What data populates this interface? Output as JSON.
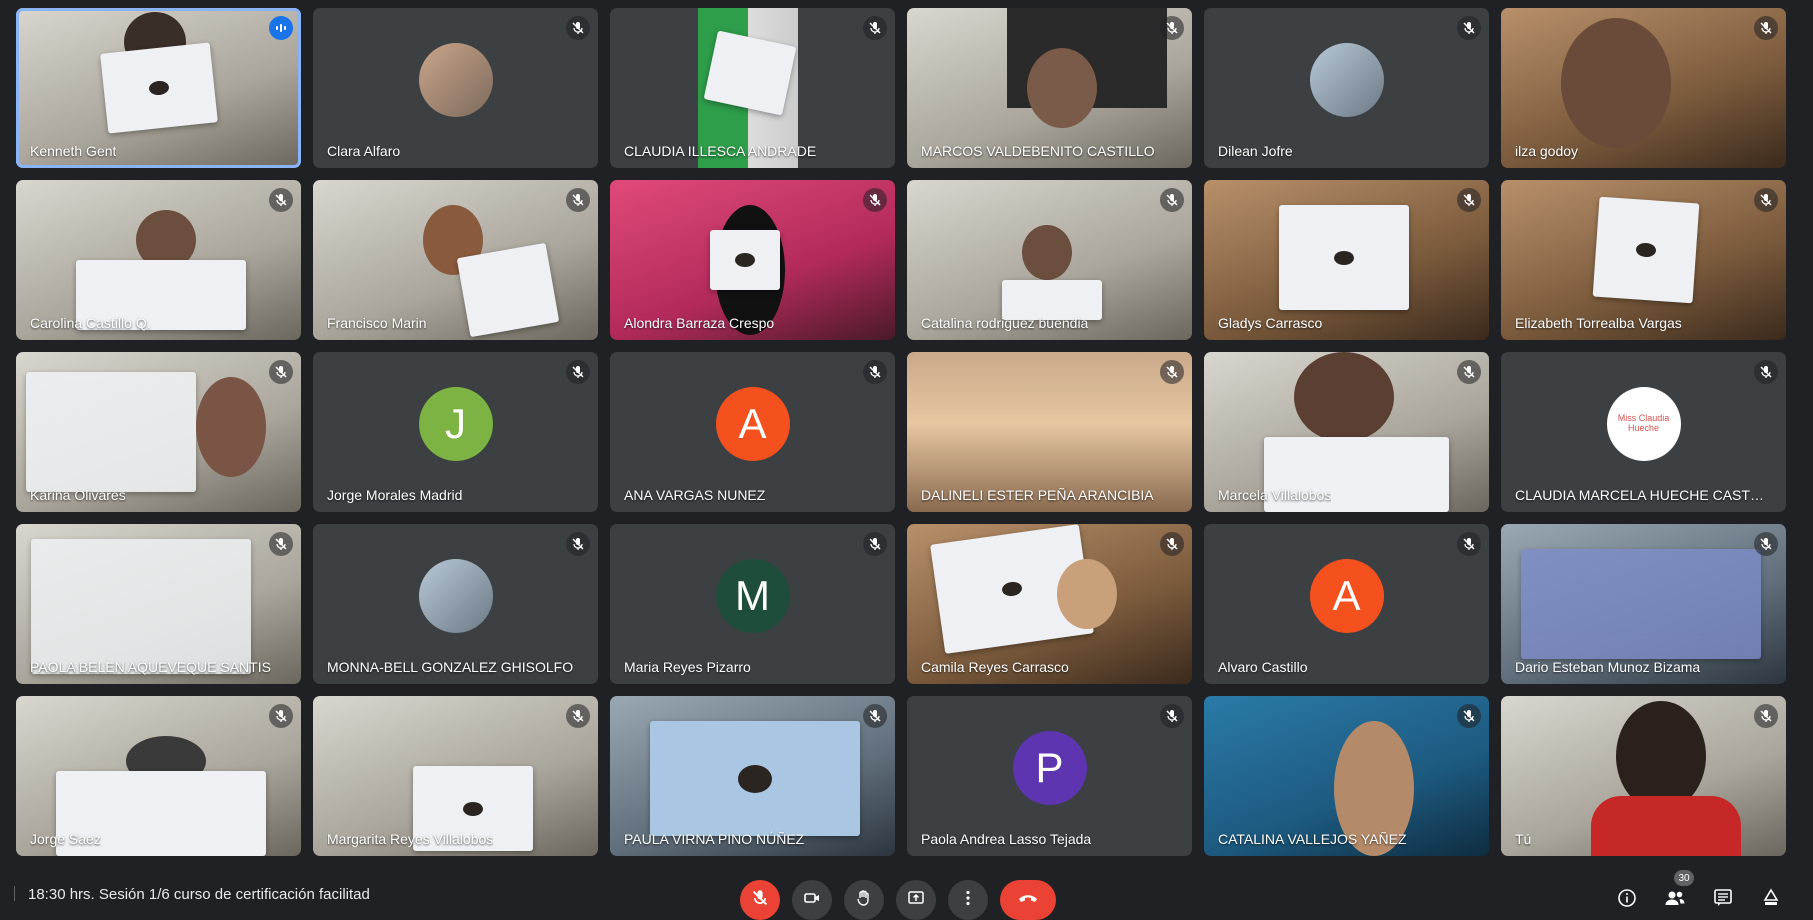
{
  "participants": [
    {
      "name": "Kenneth Gent",
      "speaking": true
    },
    {
      "name": "Clara Alfaro"
    },
    {
      "name": "CLAUDIA ILLESCA ANDRADE"
    },
    {
      "name": "MARCOS VALDEBENITO CASTILLO"
    },
    {
      "name": "Dilean Jofre"
    },
    {
      "name": "ilza godoy"
    },
    {
      "name": "Carolina Castillo Q."
    },
    {
      "name": "Francisco Marin"
    },
    {
      "name": "Alondra Barraza Crespo"
    },
    {
      "name": "Catalina rodriguez buendia"
    },
    {
      "name": "Gladys Carrasco"
    },
    {
      "name": "Elizabeth Torrealba Vargas"
    },
    {
      "name": "Karina Olivares"
    },
    {
      "name": "Jorge Morales Madrid",
      "initial": "J",
      "color": "#7cb342"
    },
    {
      "name": "ANA VARGAS NUNEZ",
      "initial": "A",
      "color": "#f4511e"
    },
    {
      "name": "DALINELI ESTER PEÑA ARANCIBIA"
    },
    {
      "name": "Marcela Villalobos"
    },
    {
      "name": "CLAUDIA MARCELA HUECHE CASTR...",
      "logo_text": "Miss Claudia Hueche"
    },
    {
      "name": "PAOLA BELEN AQUEVEQUE SANTIS"
    },
    {
      "name": "MONNA-BELL GONZALEZ GHISOLFO"
    },
    {
      "name": "Maria Reyes Pizarro",
      "initial": "M",
      "color": "#1e4d3b"
    },
    {
      "name": "Camila Reyes Carrasco"
    },
    {
      "name": "Alvaro Castillo",
      "initial": "A",
      "color": "#f4511e"
    },
    {
      "name": "Dario Esteban Munoz Bizama"
    },
    {
      "name": "Jorge Saez"
    },
    {
      "name": "Margarita Reyes Villalobos"
    },
    {
      "name": "PAULA VIRNA PINO NÚÑEZ"
    },
    {
      "name": "Paola Andrea Lasso Tejada",
      "initial": "P",
      "color": "#5e35b1"
    },
    {
      "name": "CATALINA VALLEJOS YAÑEZ"
    },
    {
      "name": "Tú"
    }
  ],
  "bottom_bar": {
    "meeting_title": "18:30 hrs. Sesión 1/6 curso de certificación facilitad",
    "people_count": "30"
  },
  "icons": [
    "mic-off-icon",
    "speaking-icon",
    "camera-icon",
    "raise-hand-icon",
    "present-icon",
    "more-options-icon",
    "end-call-icon",
    "info-icon",
    "people-icon",
    "chat-icon",
    "activities-icon"
  ],
  "colors": {
    "background": "#202124",
    "tile": "#3c4043",
    "accent": "#8ab4f8",
    "danger": "#ea4335"
  }
}
